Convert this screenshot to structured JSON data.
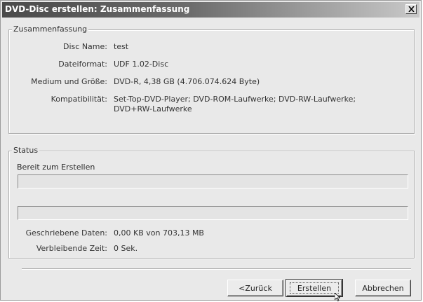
{
  "window": {
    "title": "DVD-Disc erstellen: Zusammenfassung",
    "close_glyph": "✕"
  },
  "summary": {
    "group_label": "Zusammenfassung",
    "rows": [
      {
        "label": "Disc Name:",
        "value": "test"
      },
      {
        "label": "Dateiformat:",
        "value": "UDF 1.02-Disc"
      },
      {
        "label": "Medium und Größe:",
        "value": "DVD-R, 4,38 GB (4.706.074.624 Byte)"
      },
      {
        "label": "Kompatibilität:",
        "value": "Set-Top-DVD-Player; DVD-ROM-Laufwerke; DVD-RW-Laufwerke;",
        "value2": "DVD+RW-Laufwerke"
      }
    ]
  },
  "status": {
    "group_label": "Status",
    "state_text": "Bereit zum Erstellen",
    "progress1": 0,
    "progress2": 0,
    "written_label": "Geschriebene Daten:",
    "written_value": "0,00 KB von 703,13 MB",
    "remaining_label": "Verbleibende Zeit:",
    "remaining_value": "0 Sek."
  },
  "buttons": {
    "back": "<Zurück",
    "create": "Erstellen",
    "cancel": "Abbrechen"
  },
  "colors": {
    "titlebar_start": "#4a4a4a",
    "window_bg": "#e9e9e9"
  }
}
